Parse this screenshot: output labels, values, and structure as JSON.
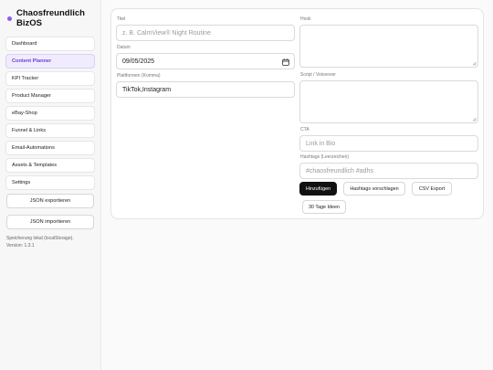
{
  "brand": {
    "title": "Chaosfreundlich BizOS",
    "accent": "#8b5cf6"
  },
  "sidebar": {
    "items": [
      {
        "label": "Dashboard",
        "active": false
      },
      {
        "label": "Content Planner",
        "active": true
      },
      {
        "label": "KPI Tracker",
        "active": false
      },
      {
        "label": "Product Manager",
        "active": false
      },
      {
        "label": "eBay-Shop",
        "active": false
      },
      {
        "label": "Funnel & Links",
        "active": false
      },
      {
        "label": "Email-Automations",
        "active": false
      },
      {
        "label": "Assets & Templates",
        "active": false
      },
      {
        "label": "Settings",
        "active": false
      }
    ],
    "export_label": "JSON exportieren",
    "import_label": "JSON importieren",
    "storage_note_line1": "Speicherung lokal (localStorage).",
    "storage_note_line2": "Version: 1.3.1"
  },
  "form": {
    "title": {
      "label": "Titel",
      "placeholder": "z. B. CalmView® Night Routine",
      "value": ""
    },
    "date": {
      "label": "Datum",
      "value": "09/05/2025"
    },
    "platforms": {
      "label": "Plattformen (Komma)",
      "value": "TikTok,Instagram"
    },
    "hook": {
      "label": "Hook",
      "value": ""
    },
    "script": {
      "label": "Script / Voiceover",
      "value": ""
    },
    "cta": {
      "label": "CTA",
      "placeholder": "Link in Bio",
      "value": ""
    },
    "hashtags": {
      "label": "Hashtags (Leerzeichen)",
      "placeholder": "#chaosfreundlich #adhs",
      "value": ""
    }
  },
  "actions": {
    "add": "Hinzufügen",
    "suggest": "Hashtags vorschlagen",
    "csv": "CSV Export",
    "ideas": "30 Tage Ideen"
  }
}
